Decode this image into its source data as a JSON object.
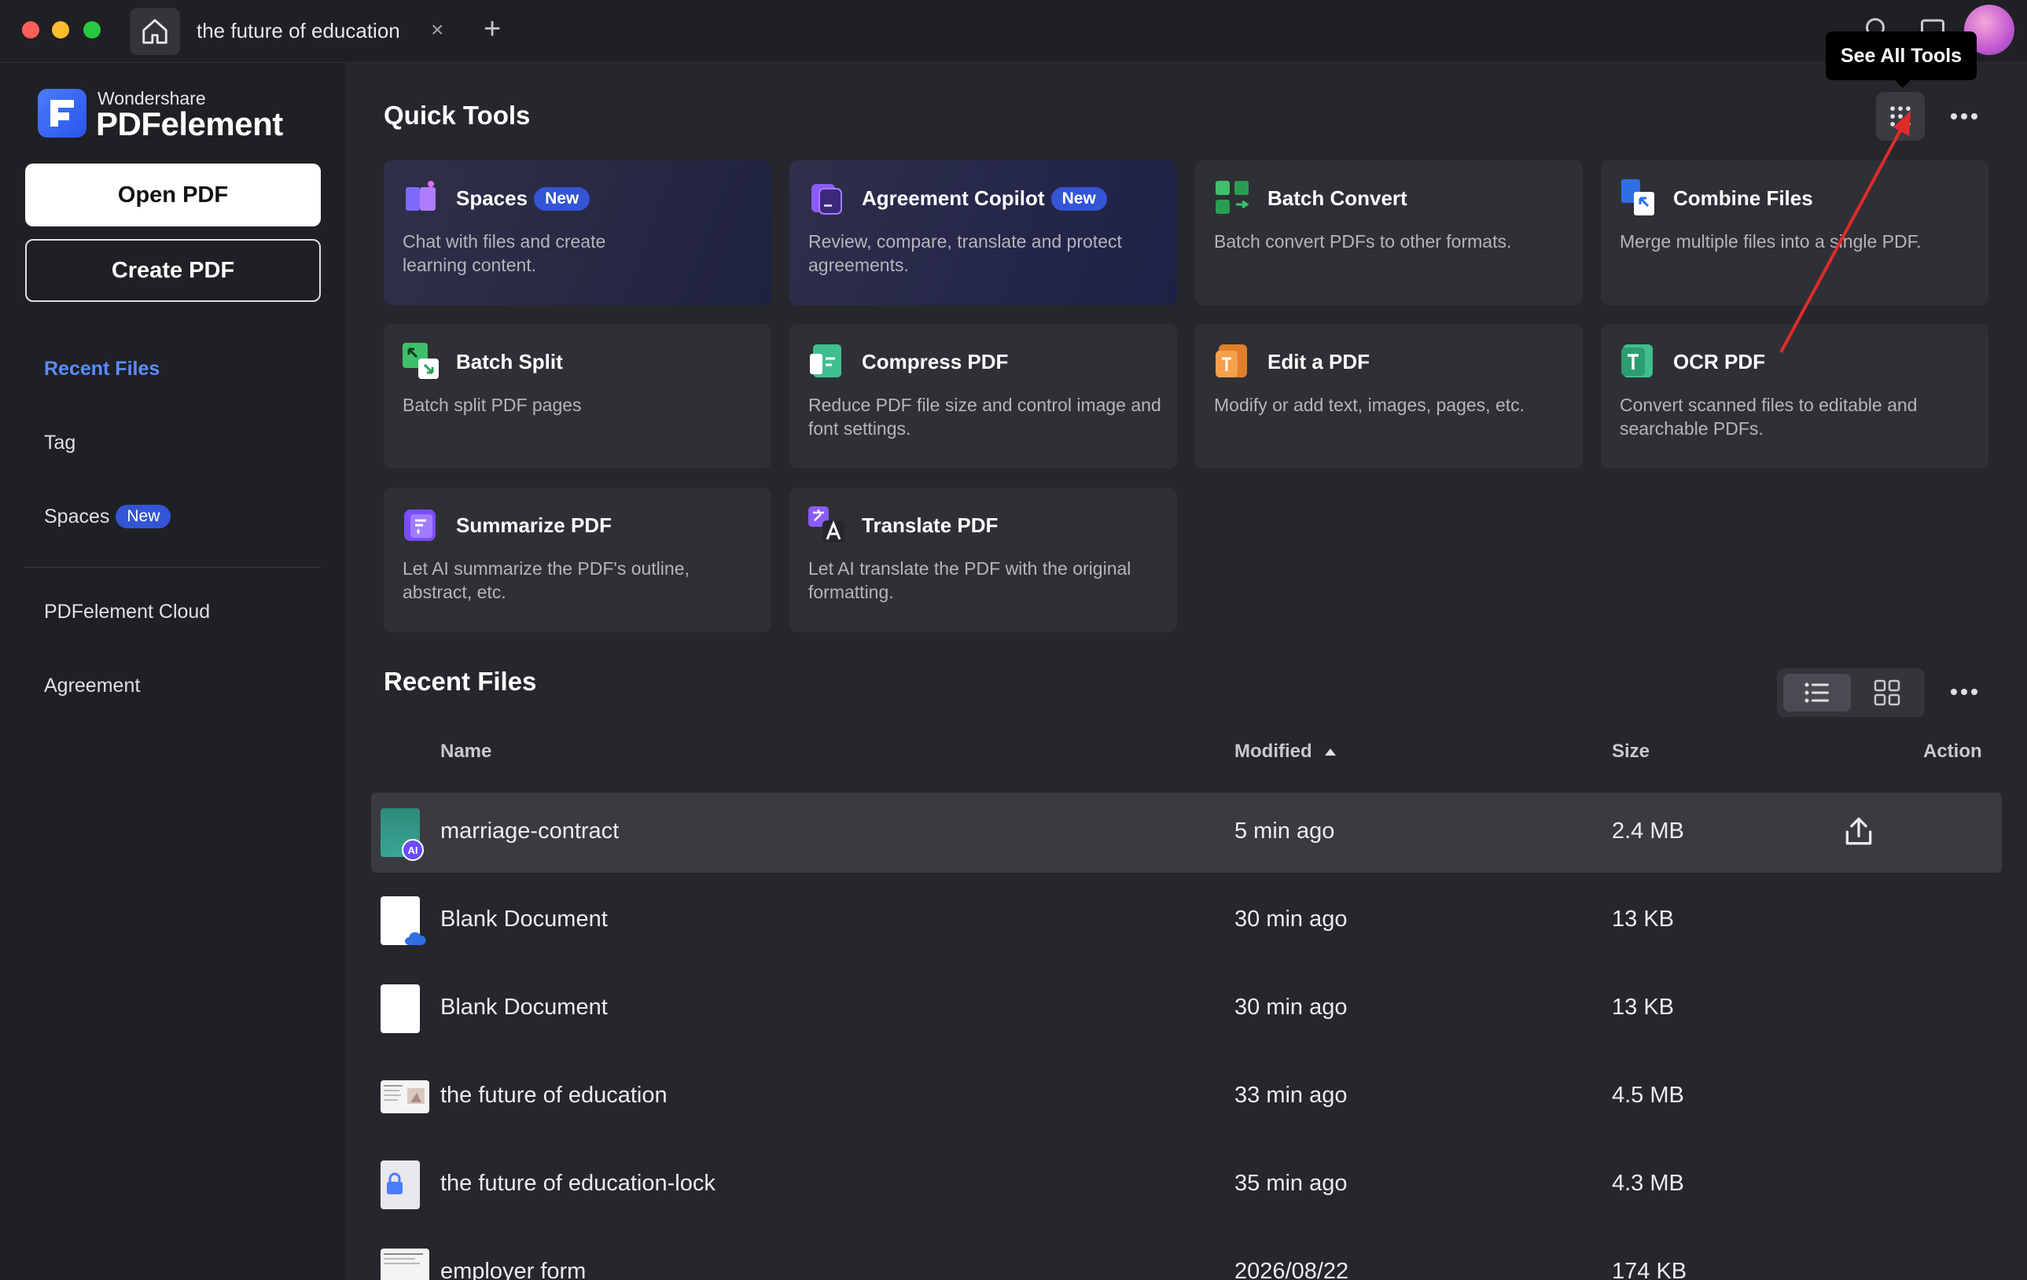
{
  "tab": {
    "title": "the future of education",
    "close": "×",
    "add": "+"
  },
  "tooltip": {
    "text": "See All Tools"
  },
  "sidebar": {
    "logo_small": "Wondershare",
    "logo_big": "PDFelement",
    "open_pdf": "Open PDF",
    "create_pdf": "Create PDF",
    "items": [
      {
        "label": "Recent Files",
        "active": true
      },
      {
        "label": "Tag"
      },
      {
        "label": "Spaces",
        "badge": "New"
      },
      {
        "label": "PDFelement Cloud"
      },
      {
        "label": "Agreement"
      }
    ]
  },
  "quick_tools": {
    "title": "Quick Tools",
    "tools": [
      {
        "title": "Spaces",
        "badge": "New",
        "desc": "Chat with files and create learning content.",
        "icon": "spaces-icon"
      },
      {
        "title": "Agreement Copilot",
        "badge": "New",
        "desc": "Review, compare, translate and protect agreements.",
        "icon": "agreement-copilot-icon"
      },
      {
        "title": "Batch Convert",
        "desc": "Batch convert PDFs to other formats.",
        "icon": "batch-convert-icon"
      },
      {
        "title": "Combine Files",
        "desc": "Merge multiple files into a single PDF.",
        "icon": "combine-files-icon"
      },
      {
        "title": "Batch Split",
        "desc": "Batch split PDF pages",
        "icon": "batch-split-icon"
      },
      {
        "title": "Compress PDF",
        "desc": "Reduce PDF file size and control image and font settings.",
        "icon": "compress-pdf-icon"
      },
      {
        "title": "Edit a PDF",
        "desc": "Modify or add text, images, pages, etc.",
        "icon": "edit-pdf-icon"
      },
      {
        "title": "OCR PDF",
        "desc": "Convert scanned files to editable and searchable PDFs.",
        "icon": "ocr-pdf-icon"
      },
      {
        "title": "Summarize PDF",
        "desc": "Let AI summarize the PDF's outline, abstract, etc.",
        "icon": "summarize-pdf-icon"
      },
      {
        "title": "Translate PDF",
        "desc": "Let AI translate the PDF with the original formatting.",
        "icon": "translate-pdf-icon"
      }
    ]
  },
  "recent_files": {
    "title": "Recent Files",
    "columns": {
      "name": "Name",
      "modified": "Modified",
      "size": "Size",
      "action": "Action"
    },
    "rows": [
      {
        "name": "marriage-contract",
        "modified": "5 min ago",
        "size": "2.4 MB",
        "selected": true
      },
      {
        "name": "Blank Document",
        "modified": "30 min ago",
        "size": "13 KB"
      },
      {
        "name": "Blank Document",
        "modified": "30 min ago",
        "size": "13 KB"
      },
      {
        "name": "the future of education",
        "modified": "33 min ago",
        "size": "4.5 MB"
      },
      {
        "name": "the future of education-lock",
        "modified": "35 min ago",
        "size": "4.3 MB"
      },
      {
        "name": "employer form",
        "modified": "2026/08/22",
        "size": "174 KB"
      }
    ]
  },
  "colors": {
    "accent": "#5b8cff",
    "badge": "#3355d6",
    "annotation_arrow": "#e02b2b"
  }
}
